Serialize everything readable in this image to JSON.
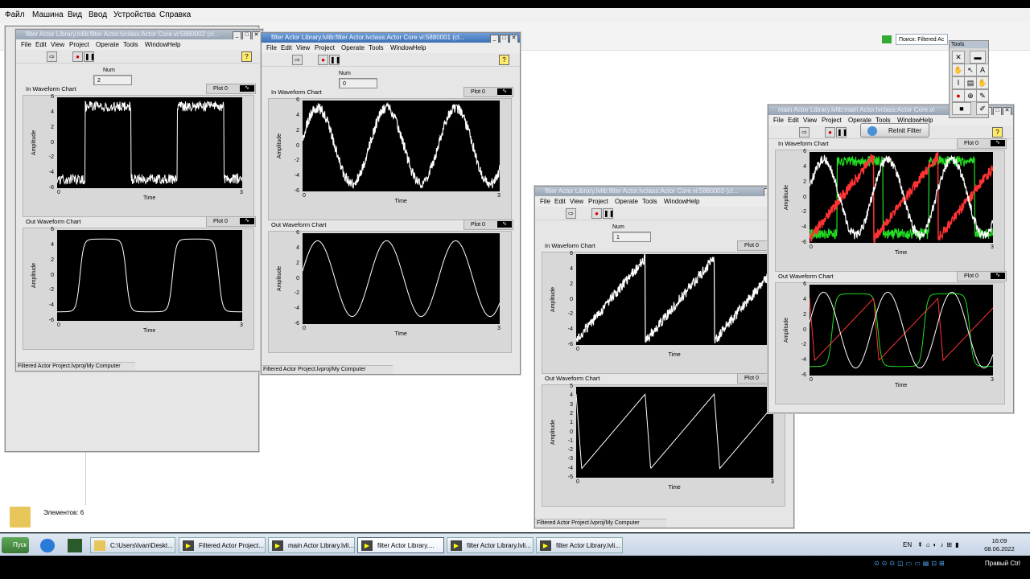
{
  "host_menu": [
    "Файл",
    "Машина",
    "Вид",
    "Ввод",
    "Устройства",
    "Справка"
  ],
  "explorer": {
    "search_placeholder": "Поиск: Filtered Ac",
    "status_items": "Элементов: 6"
  },
  "lv_menu": [
    "File",
    "Edit",
    "View",
    "Project",
    "Operate",
    "Tools",
    "Window",
    "Help"
  ],
  "labels": {
    "num": "Num",
    "in_chart": "In Waveform Chart",
    "out_chart": "Out Waveform Chart",
    "plot0": "Plot 0",
    "amplitude": "Amplitude",
    "time": "Time",
    "project_path": "Filtered Actor Project.lvproj/My Computer"
  },
  "windows": [
    {
      "id": "w1",
      "title": "filter Actor Library.lvlib:filter Actor.lvclass:Actor Core.vi:5880002 (cl...",
      "num_value": "2",
      "in": {
        "kind": "square",
        "ymin": -6,
        "ymax": 6,
        "yticks": [
          6,
          4,
          2,
          0,
          -2,
          -4,
          -6
        ],
        "xticks": [
          "0",
          "3"
        ]
      },
      "out": {
        "kind": "square_filtered",
        "ymin": -6,
        "ymax": 6,
        "yticks": [
          6,
          4,
          2,
          0,
          -2,
          -4,
          -6
        ],
        "xticks": [
          "0",
          "3"
        ]
      }
    },
    {
      "id": "w2",
      "title": "filter Actor Library.lvlib:filter Actor.lvclass:Actor Core.vi:5880001 (cl...",
      "num_value": "0",
      "in": {
        "kind": "sine",
        "ymin": -6,
        "ymax": 6,
        "yticks": [
          6,
          4,
          2,
          0,
          -2,
          -4,
          -6
        ],
        "xticks": [
          "0",
          "3"
        ]
      },
      "out": {
        "kind": "sine_filtered",
        "ymin": -6,
        "ymax": 6,
        "yticks": [
          6,
          4,
          2,
          0,
          -2,
          -4,
          -6
        ],
        "xticks": [
          "0",
          "3"
        ]
      }
    },
    {
      "id": "w3",
      "title": "filter Actor Library.lvlib:filter Actor.lvclass:Actor Core.vi:5880003 (cl...",
      "num_value": "1",
      "in": {
        "kind": "saw",
        "ymin": -6,
        "ymax": 6,
        "yticks": [
          6,
          4,
          2,
          0,
          -2,
          -4,
          -6
        ],
        "xticks": [
          "0",
          "3"
        ]
      },
      "out": {
        "kind": "saw_filtered",
        "ymin": -5,
        "ymax": 5,
        "yticks": [
          5,
          4,
          3,
          2,
          1,
          0,
          -1,
          -2,
          -3,
          -4,
          -5
        ],
        "xticks": [
          "0",
          "3"
        ]
      }
    },
    {
      "id": "w4",
      "title": "main Actor Library.lvlib:main Actor.lvclass:Actor Core.vi",
      "reinit_label": "ReInit Filter",
      "in": {
        "kind": "combined",
        "ymin": -6,
        "ymax": 6,
        "yticks": [
          6,
          4,
          2,
          0,
          -2,
          -4,
          -6
        ],
        "xticks": [
          "0",
          "3"
        ]
      },
      "out": {
        "kind": "combined_filtered",
        "ymin": -6,
        "ymax": 6,
        "yticks": [
          6,
          4,
          2,
          0,
          -2,
          -4,
          -6
        ],
        "xticks": [
          "0",
          "3"
        ]
      }
    }
  ],
  "tools_title": "Tools",
  "taskbar": {
    "start": "Пуск",
    "items": [
      "C:\\Users\\Ivan\\Deskt...",
      "Filtered Actor Project...",
      "main Actor Library.lvli...",
      "filter Actor Library....",
      "filter Actor Library.lvli...",
      "filter Actor Library.lvli..."
    ],
    "lang": "EN",
    "time": "16:09",
    "date": "08.06.2022",
    "bottom_right": "Правый Ctrl"
  },
  "colors": {
    "green": "#22dd22",
    "red": "#ff3333",
    "white": "#ffffff",
    "plot_bg": "#000000"
  }
}
